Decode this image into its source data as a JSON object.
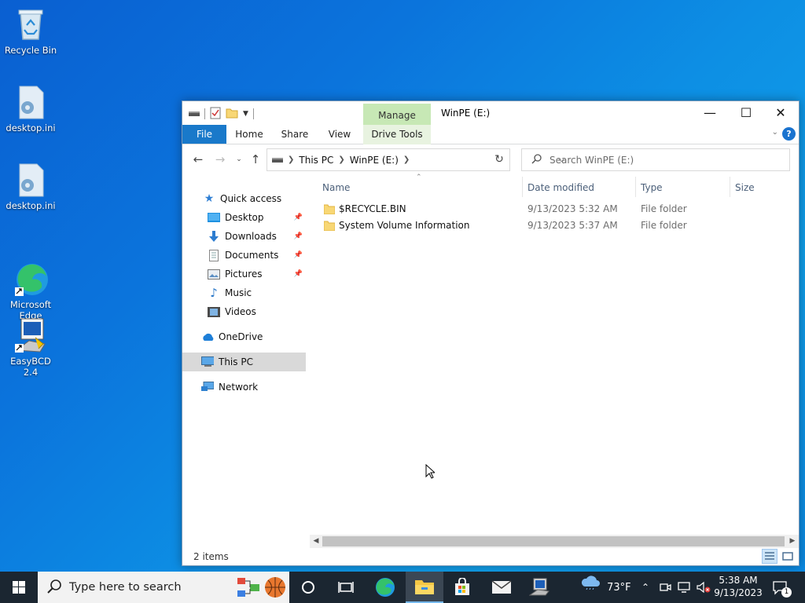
{
  "desktop": {
    "icons": [
      {
        "label": "Recycle Bin"
      },
      {
        "label": "desktop.ini"
      },
      {
        "label": "desktop.ini"
      },
      {
        "label": "Microsoft\nEdge"
      },
      {
        "label": "EasyBCD 2.4"
      }
    ]
  },
  "window": {
    "title": "WinPE (E:)",
    "contextual_tab": "Manage",
    "contextual_subtab": "Drive Tools",
    "ribbon_tabs": [
      "File",
      "Home",
      "Share",
      "View"
    ],
    "help_label": "?",
    "caption": {
      "minimize": "—",
      "maximize": "☐",
      "close": "✕"
    },
    "breadcrumb": [
      "This PC",
      "WinPE (E:)"
    ],
    "search_placeholder": "Search WinPE (E:)",
    "nav": {
      "quick_access": "Quick access",
      "items": [
        "Desktop",
        "Downloads",
        "Documents",
        "Pictures",
        "Music",
        "Videos"
      ],
      "onedrive": "OneDrive",
      "this_pc": "This PC",
      "network": "Network"
    },
    "columns": {
      "name": "Name",
      "date": "Date modified",
      "type": "Type",
      "size": "Size"
    },
    "files": [
      {
        "name": "$RECYCLE.BIN",
        "date": "9/13/2023 5:32 AM",
        "type": "File folder"
      },
      {
        "name": "System Volume Information",
        "date": "9/13/2023 5:37 AM",
        "type": "File folder"
      }
    ],
    "status": {
      "count": "2 items"
    }
  },
  "taskbar": {
    "search_placeholder": "Type here to search",
    "weather": "73°F",
    "time": "5:38 AM",
    "date": "9/13/2023",
    "notification_count": "1"
  },
  "colors": {
    "accent": "#1979ca",
    "manage_tab": "#c7e8b5",
    "taskbar": "#1b2631"
  }
}
